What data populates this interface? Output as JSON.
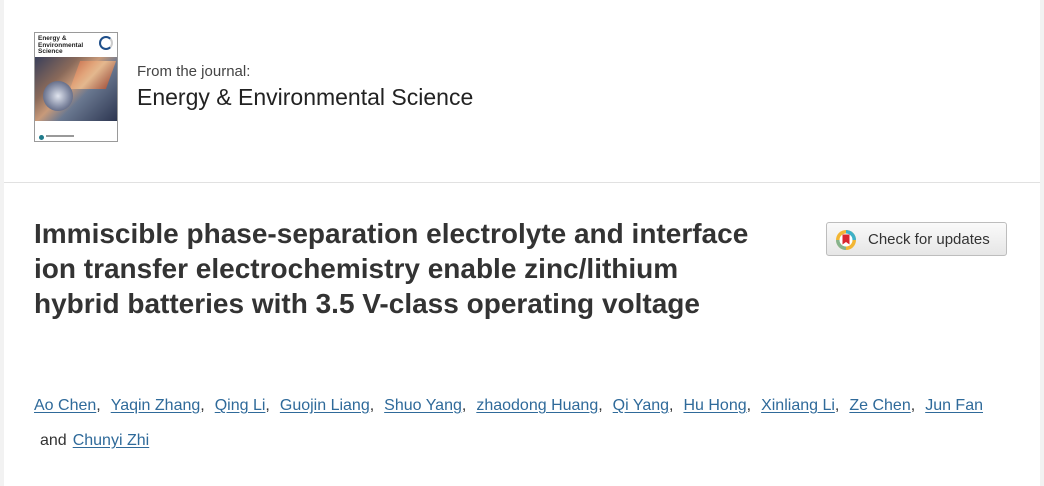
{
  "journal": {
    "from_label": "From the journal:",
    "name": "Energy & Environmental Science",
    "cover_title_line1": "Energy &",
    "cover_title_line2": "Environmental",
    "cover_title_line3": "Science"
  },
  "article": {
    "title": "Immiscible phase-separation electrolyte and interface ion transfer electrochemistry enable zinc/lithium hybrid batteries with 3.5 V-class operating voltage"
  },
  "check_updates": {
    "label": "Check for updates"
  },
  "authors": {
    "list": [
      "Ao Chen",
      "Yaqin Zhang",
      "Qing Li",
      "Guojin Liang",
      "Shuo Yang",
      "zhaodong Huang",
      "Qi Yang",
      "Hu Hong",
      "Xinliang Li",
      "Ze Chen",
      "Jun Fan"
    ],
    "last": "Chunyi Zhi",
    "separator": ",",
    "and_text": "and"
  },
  "colors": {
    "link": "#2f6a9a",
    "title": "#333333",
    "background": "#ffffff"
  }
}
